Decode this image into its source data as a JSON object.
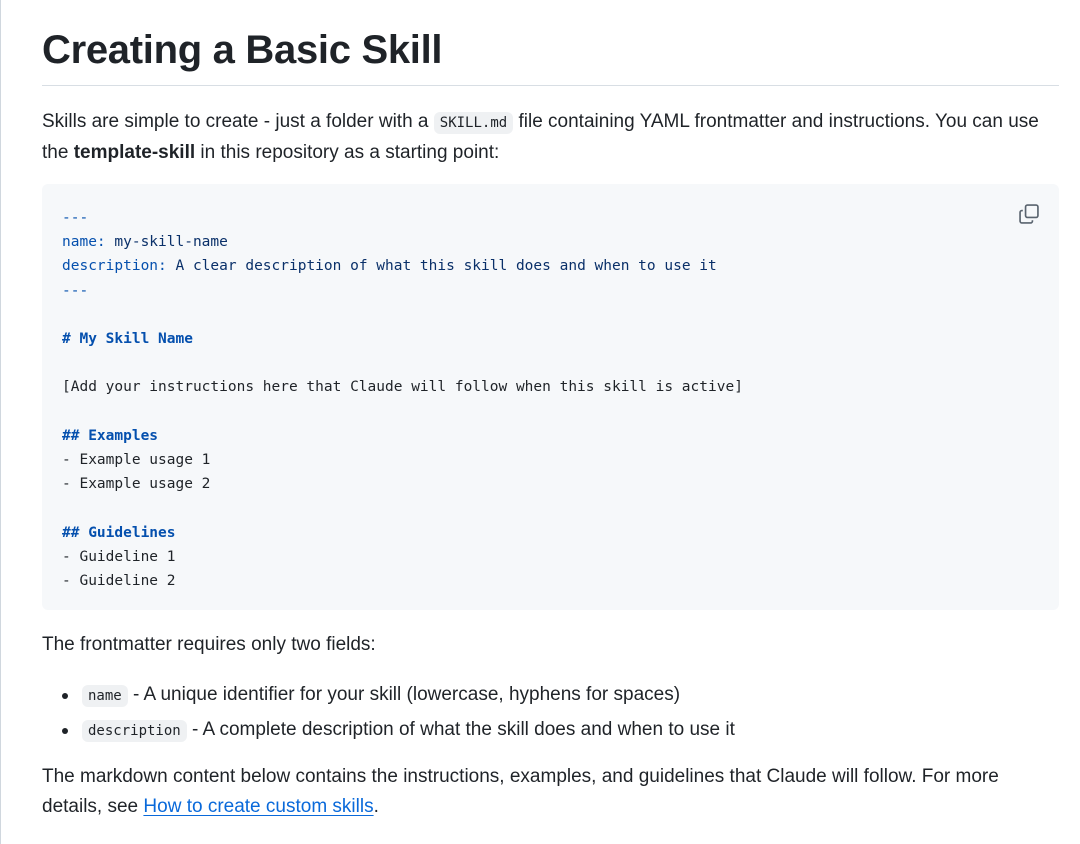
{
  "heading": "Creating a Basic Skill",
  "intro": {
    "text1": "Skills are simple to create - just a folder with a ",
    "code": "SKILL.md",
    "text2": " file containing YAML frontmatter and instructions. You can use the ",
    "bold": "template-skill",
    "text3": " in this repository as a starting point:"
  },
  "code_block": {
    "copy_icon": "copy-icon",
    "lines": {
      "fm_open": "---",
      "name_key": "name:",
      "name_val": " my-skill-name",
      "desc_key": "description:",
      "desc_val": " A clear description of what this skill does and when to use it",
      "fm_close": "---",
      "h1": "# My Skill Name",
      "instructions": "[Add your instructions here that Claude will follow when this skill is active]",
      "h2_examples": "## Examples",
      "ex1": "- Example usage 1",
      "ex2": "- Example usage 2",
      "h2_guidelines": "## Guidelines",
      "g1": "- Guideline 1",
      "g2": "- Guideline 2"
    }
  },
  "fields_intro": "The frontmatter requires only two fields:",
  "fields": [
    {
      "code": "name",
      "text": " - A unique identifier for your skill (lowercase, hyphens for spaces)"
    },
    {
      "code": "description",
      "text": " - A complete description of what the skill does and when to use it"
    }
  ],
  "outro": {
    "text1": "The markdown content below contains the instructions, examples, and guidelines that Claude will follow. For more details, see ",
    "link": "How to create custom skills",
    "text2": "."
  }
}
